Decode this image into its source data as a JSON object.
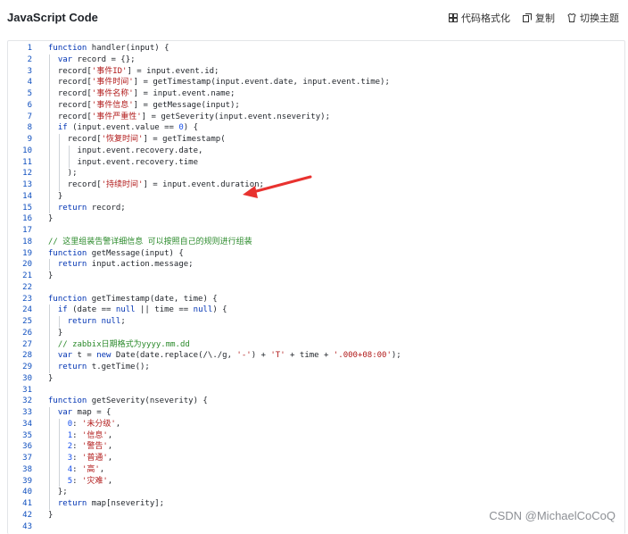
{
  "header": {
    "title": "JavaScript Code",
    "actions": [
      {
        "label": "代码格式化",
        "icon": "format-icon"
      },
      {
        "label": "复制",
        "icon": "copy-icon"
      },
      {
        "label": "切换主题",
        "icon": "theme-icon"
      }
    ]
  },
  "code_lines": [
    {
      "n": "1",
      "t": "function handler(input) {"
    },
    {
      "n": "2",
      "t": "  var record = {};"
    },
    {
      "n": "3",
      "t": "  record['事件ID'] = input.event.id;"
    },
    {
      "n": "4",
      "t": "  record['事件时间'] = getTimestamp(input.event.date, input.event.time);"
    },
    {
      "n": "5",
      "t": "  record['事件名称'] = input.event.name;"
    },
    {
      "n": "6",
      "t": "  record['事件信息'] = getMessage(input);"
    },
    {
      "n": "7",
      "t": "  record['事件严重性'] = getSeverity(input.event.nseverity);"
    },
    {
      "n": "8",
      "t": "  if (input.event.value == 0) {"
    },
    {
      "n": "9",
      "t": "    record['恢复时间'] = getTimestamp("
    },
    {
      "n": "10",
      "t": "      input.event.recovery.date,"
    },
    {
      "n": "11",
      "t": "      input.event.recovery.time"
    },
    {
      "n": "12",
      "t": "    );"
    },
    {
      "n": "13",
      "t": "    record['持续时间'] = input.event.duration;"
    },
    {
      "n": "14",
      "t": "  }"
    },
    {
      "n": "15",
      "t": "  return record;"
    },
    {
      "n": "16",
      "t": "}"
    },
    {
      "n": "17",
      "t": ""
    },
    {
      "n": "18",
      "t": "// 这里组装告警详细信息 可以按照自己的规则进行组装"
    },
    {
      "n": "19",
      "t": "function getMessage(input) {"
    },
    {
      "n": "20",
      "t": "  return input.action.message;"
    },
    {
      "n": "21",
      "t": "}"
    },
    {
      "n": "22",
      "t": ""
    },
    {
      "n": "23",
      "t": "function getTimestamp(date, time) {"
    },
    {
      "n": "24",
      "t": "  if (date == null || time == null) {"
    },
    {
      "n": "25",
      "t": "    return null;"
    },
    {
      "n": "26",
      "t": "  }"
    },
    {
      "n": "27",
      "t": "  // zabbix日期格式为yyyy.mm.dd"
    },
    {
      "n": "28",
      "t": "  var t = new Date(date.replace(/\\./g, '-') + 'T' + time + '.000+08:00');"
    },
    {
      "n": "29",
      "t": "  return t.getTime();"
    },
    {
      "n": "30",
      "t": "}"
    },
    {
      "n": "31",
      "t": ""
    },
    {
      "n": "32",
      "t": "function getSeverity(nseverity) {"
    },
    {
      "n": "33",
      "t": "  var map = {"
    },
    {
      "n": "34",
      "t": "    0: '未分级',"
    },
    {
      "n": "35",
      "t": "    1: '信息',"
    },
    {
      "n": "36",
      "t": "    2: '警告',"
    },
    {
      "n": "37",
      "t": "    3: '普通',"
    },
    {
      "n": "38",
      "t": "    4: '高',"
    },
    {
      "n": "39",
      "t": "    5: '灾难',"
    },
    {
      "n": "40",
      "t": "  };"
    },
    {
      "n": "41",
      "t": "  return map[nseverity];"
    },
    {
      "n": "42",
      "t": "}"
    },
    {
      "n": "43",
      "t": ""
    }
  ],
  "watermark": "CSDN @MichaelCoCoQ",
  "colors": {
    "arrow": "#e8322f",
    "line_numbers": "#0f4fbf"
  }
}
